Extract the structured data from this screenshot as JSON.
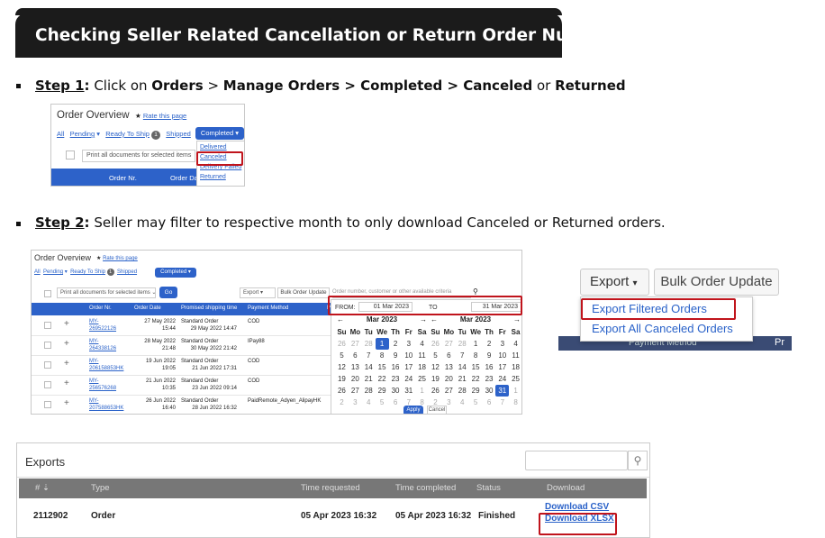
{
  "title": "Checking Seller Related Cancellation or Return Order Number",
  "step1": {
    "label": "Step 1",
    "colon": ":",
    "t1": " Click on ",
    "orders": "Orders",
    "sep1": " > ",
    "manage": "Manage Orders > Completed > Canceled",
    "or": " or ",
    "returned": "Returned"
  },
  "step2": {
    "label": "Step 2",
    "colon": ":",
    "text": " Seller may filter to respective month to only download Canceled or Returned orders."
  },
  "ov1": {
    "title": "Order Overview",
    "rate": "Rate this page",
    "tabs": {
      "all": "All",
      "pending": "Pending",
      "ready": "Ready To Ship",
      "ready_count": "1",
      "shipped": "Shipped",
      "completed": "Completed"
    },
    "print": "Print all documents for selected items",
    "col_order": "Order Nr.",
    "col_date": "Order Da",
    "menu": [
      "Delivered",
      "Canceled",
      "Delivery Failed",
      "Returned"
    ]
  },
  "ov2": {
    "title": "Order Overview",
    "rate": "Rate this page",
    "tabs": {
      "all": "All",
      "pending": "Pending",
      "ready": "Ready To Ship",
      "ready_count": "1",
      "shipped": "Shipped",
      "completed": "Completed"
    },
    "print": "Print all documents for selected items",
    "go": "Go",
    "export": "Export",
    "bulk": "Bulk Order Update",
    "search_ph": "Order number, customer or other available criteria",
    "cols": [
      "Order Nr.",
      "Order Date",
      "Promised shipping time",
      "Payment Method",
      "P"
    ],
    "rows": [
      {
        "nr": "MY-",
        "nr2": "269522126",
        "date": "27 May 2022",
        "time": "15:44",
        "type": "Standard Order",
        "ship": "29 May 2022 14:47",
        "pay": "COD"
      },
      {
        "nr": "MY-",
        "nr2": "264338126",
        "date": "28 May 2022",
        "time": "21:48",
        "type": "Standard Order",
        "ship": "30 May 2022 21:42",
        "pay": "IPay88"
      },
      {
        "nr": "MY-",
        "nr2": "206158853HK",
        "date": "19 Jun 2022",
        "time": "19:05",
        "type": "Standard Order",
        "ship": "21 Jun 2022 17:31",
        "pay": "COD"
      },
      {
        "nr": "MY-",
        "nr2": "256576268",
        "date": "21 Jun 2022",
        "time": "10:35",
        "type": "Standard Order",
        "ship": "23 Jun 2022 09:14",
        "pay": "COD"
      },
      {
        "nr": "MY-",
        "nr2": "207588653HK",
        "date": "26 Jun 2022",
        "time": "16:40",
        "type": "Standard Order",
        "ship": "28 Jun 2022 16:32",
        "pay": "PaidRemote_Adyen_AlipayHK"
      }
    ],
    "from_label": "FROM:",
    "from_val": "01 Mar 2023",
    "to_label": "TO",
    "to_val": "31 Mar 2023",
    "month": "Mar 2023",
    "apply": "Apply",
    "cancel": "Cancel",
    "days": [
      "Su",
      "Mo",
      "Tu",
      "We",
      "Th",
      "Fr",
      "Sa"
    ],
    "cal_left": [
      [
        "26",
        "27",
        "28",
        "1",
        "2",
        "3",
        "4"
      ],
      [
        "5",
        "6",
        "7",
        "8",
        "9",
        "10",
        "11"
      ],
      [
        "12",
        "13",
        "14",
        "15",
        "16",
        "17",
        "18"
      ],
      [
        "19",
        "20",
        "21",
        "22",
        "23",
        "24",
        "25"
      ],
      [
        "26",
        "27",
        "28",
        "29",
        "30",
        "31",
        "1"
      ],
      [
        "2",
        "3",
        "4",
        "5",
        "6",
        "7",
        "8"
      ]
    ],
    "cal_right": [
      [
        "26",
        "27",
        "28",
        "1",
        "2",
        "3",
        "4"
      ],
      [
        "5",
        "6",
        "7",
        "8",
        "9",
        "10",
        "11"
      ],
      [
        "12",
        "13",
        "14",
        "15",
        "16",
        "17",
        "18"
      ],
      [
        "19",
        "20",
        "21",
        "22",
        "23",
        "24",
        "25"
      ],
      [
        "26",
        "27",
        "28",
        "29",
        "30",
        "31",
        "1"
      ],
      [
        "2",
        "3",
        "4",
        "5",
        "6",
        "7",
        "8"
      ]
    ]
  },
  "exportmenu": {
    "export": "Export",
    "bulk": "Bulk Order Update",
    "filtered": "Export Filtered Orders",
    "all": "Export All Canceled Orders",
    "bg_text": "Payment Method",
    "pr": "Pr"
  },
  "exports": {
    "title": "Exports",
    "cols": [
      "#",
      "Type",
      "Time requested",
      "Time completed",
      "Status",
      "Download"
    ],
    "row": {
      "id": "2112902",
      "type": "Order",
      "req": "05 Apr 2023 16:32",
      "comp": "05 Apr 2023 16:32",
      "status": "Finished",
      "csv": "Download CSV",
      "xlsx": "Download XLSX"
    }
  }
}
